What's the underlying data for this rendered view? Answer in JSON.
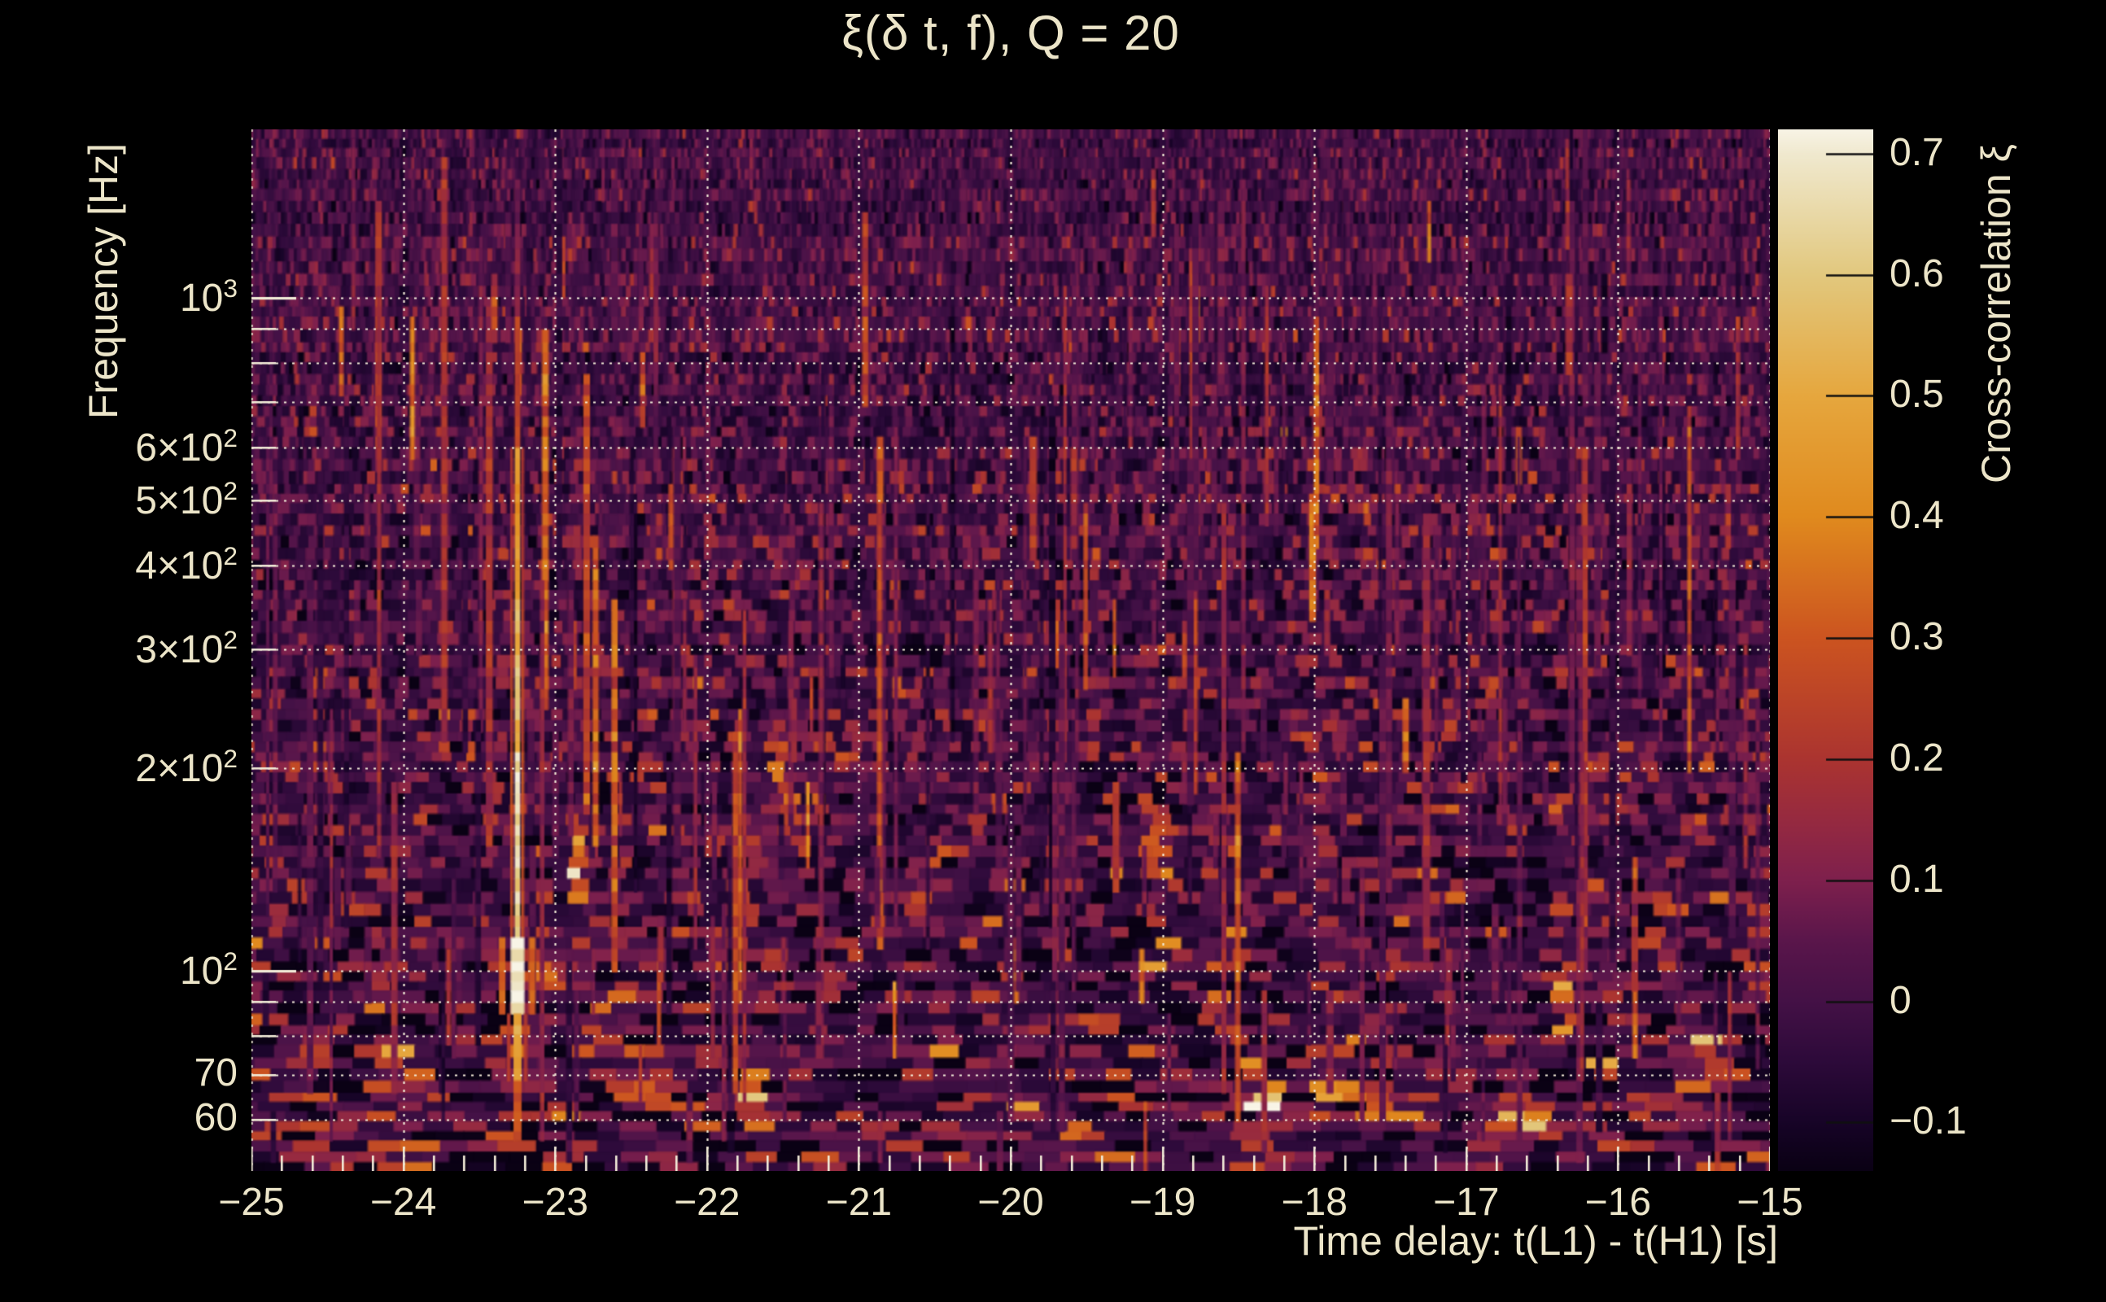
{
  "title": "ξ(δ t, f), Q = 20",
  "axes": {
    "x": {
      "label": "Time delay: t(L1) - t(H1) [s]",
      "min": -25,
      "max": -15,
      "minor_step": 0.2,
      "ticks": [
        {
          "t": -25,
          "label": "−25"
        },
        {
          "t": -24,
          "label": "−24"
        },
        {
          "t": -23,
          "label": "−23"
        },
        {
          "t": -22,
          "label": "−22"
        },
        {
          "t": -21,
          "label": "−21"
        },
        {
          "t": -20,
          "label": "−20"
        },
        {
          "t": -19,
          "label": "−19"
        },
        {
          "t": -18,
          "label": "−18"
        },
        {
          "t": -17,
          "label": "−17"
        },
        {
          "t": -16,
          "label": "−16"
        },
        {
          "t": -15,
          "label": "−15"
        }
      ]
    },
    "y": {
      "label": "Frequency [Hz]",
      "scale": "log",
      "ticks": [
        {
          "hz": 1000,
          "base": "10",
          "exp": "3"
        },
        {
          "hz": 600,
          "base": "6×10",
          "exp": "2"
        },
        {
          "hz": 500,
          "base": "5×10",
          "exp": "2"
        },
        {
          "hz": 400,
          "base": "4×10",
          "exp": "2"
        },
        {
          "hz": 300,
          "base": "3×10",
          "exp": "2"
        },
        {
          "hz": 200,
          "base": "2×10",
          "exp": "2"
        },
        {
          "hz": 100,
          "base": "10",
          "exp": "2"
        },
        {
          "hz": 70,
          "base": "70",
          "exp": ""
        },
        {
          "hz": 60,
          "base": "60",
          "exp": ""
        }
      ],
      "gridlines_hz": [
        60,
        70,
        80,
        90,
        100,
        200,
        300,
        400,
        500,
        600,
        700,
        800,
        900,
        1000
      ],
      "long_tick_hz": [
        100,
        1000
      ]
    },
    "colorbar": {
      "label": "Cross-correlation ξ",
      "min": -0.14,
      "max": 0.72,
      "ticks": [
        0.7,
        0.6,
        0.5,
        0.4,
        0.3,
        0.2,
        0.1,
        0.0,
        -0.1
      ],
      "tick_labels": [
        "0.7",
        "0.6",
        "0.5",
        "0.4",
        "0.3",
        "0.2",
        "0.1",
        "0",
        "−0.1"
      ]
    }
  },
  "chart_data": {
    "type": "heatmap",
    "title": "ξ(δ t, f), Q = 20",
    "xlabel": "Time delay: t(L1) - t(H1) [s]",
    "ylabel": "Frequency [Hz]",
    "colorbar_label": "Cross-correlation ξ",
    "x_range_s": [
      -25,
      -15
    ],
    "y_range_hz": [
      50.4,
      1780
    ],
    "y_scale": "log",
    "value_range": [
      -0.14,
      0.72
    ],
    "background_value": 0.0,
    "grid": true,
    "colormap_stops": [
      {
        "v": -0.14,
        "color": "#0a0114"
      },
      {
        "v": -0.1,
        "color": "#170427"
      },
      {
        "v": -0.05,
        "color": "#2d0a3a"
      },
      {
        "v": 0.0,
        "color": "#441146"
      },
      {
        "v": 0.05,
        "color": "#5a164b"
      },
      {
        "v": 0.1,
        "color": "#7e204d"
      },
      {
        "v": 0.15,
        "color": "#962a40"
      },
      {
        "v": 0.2,
        "color": "#ab3430"
      },
      {
        "v": 0.3,
        "color": "#cc5420"
      },
      {
        "v": 0.4,
        "color": "#e08a1e"
      },
      {
        "v": 0.5,
        "color": "#e6a73e"
      },
      {
        "v": 0.6,
        "color": "#e2c87e"
      },
      {
        "v": 0.7,
        "color": "#f0e9cf"
      },
      {
        "v": 0.72,
        "color": "#f8f4e6"
      }
    ],
    "main_feature": {
      "description": "bright narrow vertical streak (candidate event)",
      "time_delay_s": -23.25,
      "freq_span_hz": [
        55,
        1500
      ],
      "peak_xi": 0.72,
      "peak_freq_hz": [
        85,
        210
      ],
      "profile": [
        {
          "f_min": 1300,
          "f_max": 1500,
          "xi": 0.07
        },
        {
          "f_min": 950,
          "f_max": 1300,
          "xi": 0.13
        },
        {
          "f_min": 600,
          "f_max": 950,
          "xi": 0.25
        },
        {
          "f_min": 350,
          "f_max": 600,
          "xi": 0.45
        },
        {
          "f_min": 210,
          "f_max": 350,
          "xi": 0.55
        },
        {
          "f_min": 110,
          "f_max": 210,
          "xi": 0.66
        },
        {
          "f_min": 85,
          "f_max": 110,
          "xi": 0.72,
          "wide": true
        },
        {
          "f_min": 68,
          "f_max": 85,
          "xi": 0.5
        },
        {
          "f_min": 55,
          "f_max": 68,
          "xi": 0.3
        }
      ]
    },
    "hotspots": [
      {
        "t": -16.65,
        "f_hz": 60,
        "xi": 0.58,
        "rt_s": 0.1,
        "rf_dec": 0.015
      },
      {
        "t": -18.28,
        "f_hz": 64,
        "xi": 0.42,
        "rt_s": 0.1,
        "rf_dec": 0.013
      },
      {
        "t": -17.9,
        "f_hz": 66,
        "xi": 0.38,
        "rt_s": 0.09,
        "rf_dec": 0.012
      },
      {
        "t": -21.5,
        "f_hz": 185,
        "xi": 0.35,
        "rt_s": 0.04,
        "rf_dec": 0.05
      },
      {
        "t": -19.05,
        "f_hz": 155,
        "xi": 0.42,
        "rt_s": 0.05,
        "rf_dec": 0.035
      },
      {
        "t": -22.85,
        "f_hz": 150,
        "xi": 0.36,
        "rt_s": 0.04,
        "rf_dec": 0.045
      },
      {
        "t": -20.6,
        "f_hz": 128,
        "xi": 0.33,
        "rt_s": 0.05,
        "rf_dec": 0.03
      },
      {
        "t": -23.05,
        "f_hz": 100,
        "xi": 0.42,
        "rt_s": 0.06,
        "rf_dec": 0.02
      },
      {
        "t": -19.6,
        "f_hz": 58,
        "xi": 0.38,
        "rt_s": 0.08,
        "rf_dec": 0.012
      },
      {
        "t": -16.35,
        "f_hz": 95,
        "xi": 0.35,
        "rt_s": 0.05,
        "rf_dec": 0.025
      },
      {
        "t": -21.75,
        "f_hz": 65,
        "xi": 0.35,
        "rt_s": 0.08,
        "rf_dec": 0.012
      }
    ],
    "noise": {
      "seed": 1337,
      "sigma_top": 0.042,
      "sigma_bottom": 0.095,
      "streak_count": 300
    }
  },
  "style": {
    "background": "#000000",
    "text_color": "#ece5c9",
    "grid_color": "#f2ecd8",
    "tick_color": "#f2ecd8",
    "colorbar_tick_color": "#101010"
  }
}
